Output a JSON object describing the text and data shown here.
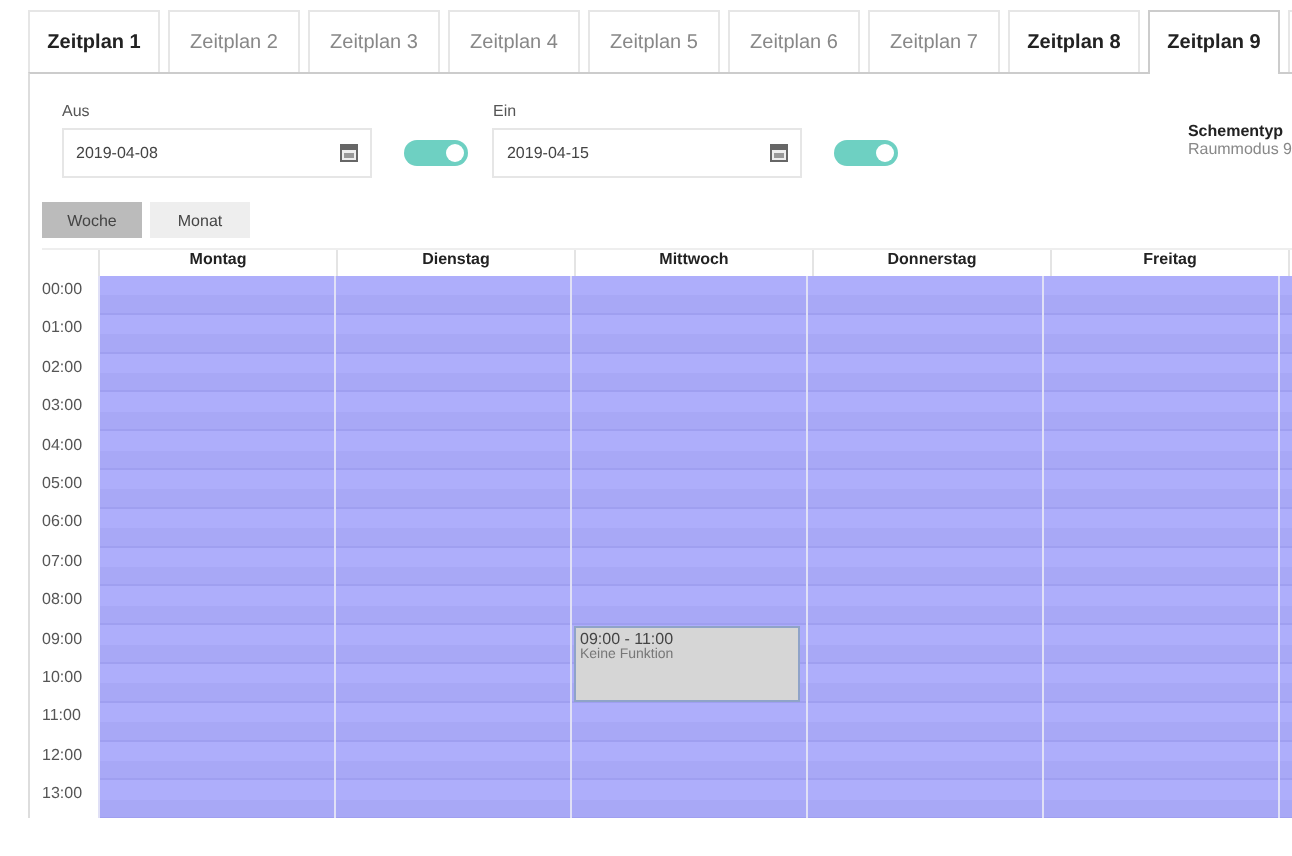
{
  "tabs": [
    {
      "label": "Zeitplan 1",
      "selected": false,
      "enabled": true
    },
    {
      "label": "Zeitplan 2",
      "selected": false,
      "enabled": false
    },
    {
      "label": "Zeitplan 3",
      "selected": false,
      "enabled": false
    },
    {
      "label": "Zeitplan 4",
      "selected": false,
      "enabled": false
    },
    {
      "label": "Zeitplan 5",
      "selected": false,
      "enabled": false
    },
    {
      "label": "Zeitplan 6",
      "selected": false,
      "enabled": false
    },
    {
      "label": "Zeitplan 7",
      "selected": false,
      "enabled": false
    },
    {
      "label": "Zeitplan 8",
      "selected": false,
      "enabled": true
    },
    {
      "label": "Zeitplan 9",
      "selected": true,
      "enabled": true
    }
  ],
  "dates": [
    {
      "label": "Aus",
      "value": "2019-04-08",
      "on": true
    },
    {
      "label": "Ein",
      "value": "2019-04-15",
      "on": true
    }
  ],
  "scheme": {
    "label": "Schementyp",
    "value": "Raummodus 9"
  },
  "views": [
    {
      "label": "Woche",
      "selected": true
    },
    {
      "label": "Monat",
      "selected": false
    }
  ],
  "calendar": {
    "days": [
      {
        "name": "Montag"
      },
      {
        "name": "Dienstag"
      },
      {
        "name": "Mittwoch",
        "events": [
          {
            "time": "09:00 - 11:00",
            "title": "Keine Funktion"
          }
        ]
      },
      {
        "name": "Donnerstag"
      },
      {
        "name": "Freitag"
      }
    ],
    "hours": [
      "00:00",
      "01:00",
      "02:00",
      "03:00",
      "04:00",
      "05:00",
      "06:00",
      "07:00",
      "08:00",
      "09:00",
      "10:00",
      "11:00",
      "12:00",
      "13:00"
    ]
  }
}
